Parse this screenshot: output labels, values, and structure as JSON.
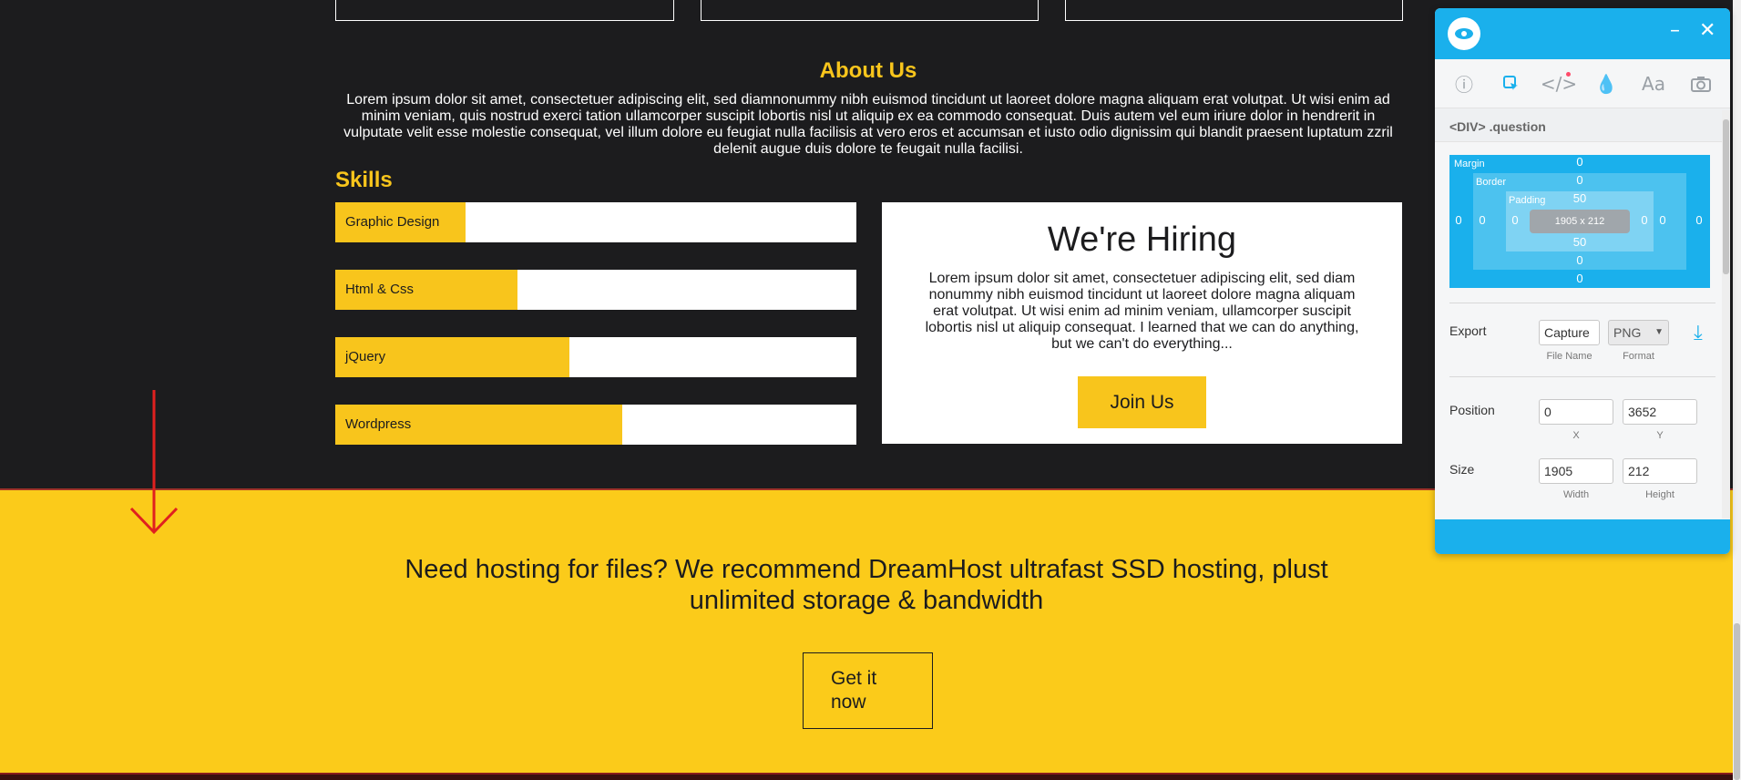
{
  "about": {
    "title": "About Us",
    "text": "Lorem ipsum dolor sit amet, consectetuer adipiscing elit, sed diamnonummy nibh euismod tincidunt ut laoreet dolore magna aliquam erat volutpat. Ut wisi enim ad minim veniam, quis nostrud exerci tation ullamcorper suscipit lobortis nisl ut aliquip ex ea commodo consequat. Duis autem vel eum iriure dolor in hendrerit in vulputate velit esse molestie consequat, vel illum dolore eu feugiat nulla facilisis at vero eros et accumsan et iusto odio dignissim qui blandit praesent luptatum zzril delenit augue duis dolore te feugait nulla facilisi."
  },
  "skills": {
    "title": "Skills",
    "items": [
      {
        "label": "Graphic Design",
        "level": 0.25
      },
      {
        "label": "Html & Css",
        "level": 0.35
      },
      {
        "label": "jQuery",
        "level": 0.45
      },
      {
        "label": "Wordpress",
        "level": 0.55
      }
    ]
  },
  "hiring": {
    "title": "We're Hiring",
    "text": "Lorem ipsum dolor sit amet, consectetuer adipiscing elit, sed diam nonummy nibh euismod tincidunt ut laoreet dolore magna aliquam erat volutpat. Ut wisi enim ad minim veniam, ullamcorper suscipit lobortis nisl ut aliquip consequat. I learned that we can do anything, but we can't do everything...",
    "button": "Join Us"
  },
  "hosting": {
    "text": "Need hosting for files? We recommend DreamHost ultrafast SSD hosting, plust unlimited storage & bandwidth",
    "button": "Get it now"
  },
  "colors": {
    "accent": "#f8c51c",
    "dark": "#1c1c1e",
    "panel_accent": "#1ab0ec",
    "annotation": "#e0201f"
  },
  "inspector": {
    "minimize": "–",
    "close": "✕",
    "tools": [
      "info-icon",
      "select-icon",
      "code-icon",
      "color-drop-icon",
      "font-icon",
      "camera-icon"
    ],
    "selector": "<DIV> .question",
    "box_model": {
      "margin_label": "Margin",
      "border_label": "Border",
      "padding_label": "Padding",
      "content": "1905 x 212",
      "margin": {
        "top": "0",
        "right": "0",
        "bottom": "0",
        "left": "0"
      },
      "border": {
        "top": "0",
        "right": "0",
        "bottom": "0",
        "left": "0"
      },
      "padding": {
        "top": "50",
        "right": "0",
        "bottom": "50",
        "left": "0"
      }
    },
    "export": {
      "label": "Export",
      "file_name": "Capture",
      "file_name_caption": "File Name",
      "format": "PNG",
      "format_caption": "Format"
    },
    "position": {
      "label": "Position",
      "x": "0",
      "y": "3652",
      "x_caption": "X",
      "y_caption": "Y"
    },
    "size": {
      "label": "Size",
      "width": "1905",
      "height": "212",
      "width_caption": "Width",
      "height_caption": "Height"
    }
  }
}
